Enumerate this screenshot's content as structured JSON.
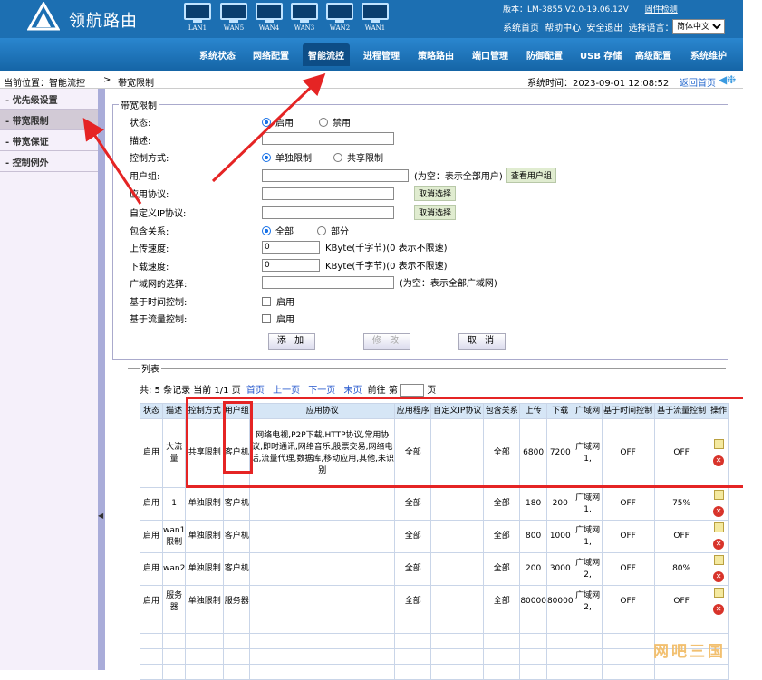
{
  "header": {
    "brand": "领航路由",
    "ports": [
      "LAN1",
      "WAN5",
      "WAN4",
      "WAN3",
      "WAN2",
      "WAN1"
    ],
    "version_label": "版本：LM-3855 V2.0-19.06.12V",
    "upgrade_link": "固件检测",
    "links": [
      "系统首页",
      "帮助中心",
      "安全退出"
    ],
    "lang_label": "选择语言：",
    "lang_value": "简体中文"
  },
  "nav": [
    "系统状态",
    "网络配置",
    "智能流控",
    "进程管理",
    "策略路由",
    "端口管理",
    "防御配置",
    "USB 存储",
    "高级配置",
    "系统维护"
  ],
  "breadcrumb": {
    "position": "当前位置：智能流控",
    "separator": ">",
    "current": "带宽限制",
    "system_time": "系统时间：2023-09-01 12:08:52",
    "home": "返回首页"
  },
  "sidebar": [
    "优先级设置",
    "带宽限制",
    "带宽保证",
    "控制例外"
  ],
  "form": {
    "legend": "带宽限制",
    "status_label": "状态:",
    "status_on": "启用",
    "status_off": "禁用",
    "desc_label": "描述:",
    "mode_label": "控制方式:",
    "mode_single": "单独限制",
    "mode_shared": "共享限制",
    "usergroup_label": "用户组:",
    "usergroup_hint": "(为空：表示全部用户)",
    "usergroup_btn": "查看用户组",
    "app_label": "应用协议:",
    "cancel_select": "取消选择",
    "custom_ip_label": "自定义IP协议:",
    "include_label": "包含关系:",
    "include_all": "全部",
    "include_part": "部分",
    "up_label": "上传速度:",
    "up_value": "0",
    "up_unit": "KByte(千字节)(0 表示不限速)",
    "down_label": "下载速度:",
    "down_value": "0",
    "down_unit": "KByte(千字节)(0 表示不限速)",
    "wan_label": "广域网的选择:",
    "wan_hint": "(为空：表示全部广域网)",
    "time_label": "基于时间控制:",
    "flow_label": "基于流量控制:",
    "enable": "启用",
    "btn_add": "添 加",
    "btn_edit": "修 改",
    "btn_cancel": "取 消"
  },
  "list": {
    "legend": "列表",
    "summary": "共: 5 条记录 当前 1/1 页",
    "first": "首页",
    "prev": "上一页",
    "next": "下一页",
    "last": "末页",
    "goto": "前往 第",
    "page_unit": "页",
    "columns": [
      "状态",
      "描述",
      "控制方式",
      "用户组",
      "应用协议",
      "应用程序",
      "自定义IP协议",
      "包含关系",
      "上传",
      "下载",
      "广域网",
      "基于时间控制",
      "基于流量控制",
      "操作"
    ],
    "rows": [
      [
        "启用",
        "大流量",
        "共享限制",
        "客户机",
        "网络电视,P2P下载,HTTP协议,常用协议,即时通讯,网络音乐,股票交易,网络电话,流量代理,数据库,移动应用,其他,未识别",
        "全部",
        "",
        "全部",
        "6800",
        "7200",
        "广域网1,",
        "OFF",
        "OFF"
      ],
      [
        "启用",
        "1",
        "单独限制",
        "客户机",
        "",
        "全部",
        "",
        "全部",
        "180",
        "200",
        "广域网1,",
        "OFF",
        "75%"
      ],
      [
        "启用",
        "wan1限制",
        "单独限制",
        "客户机",
        "",
        "全部",
        "",
        "全部",
        "800",
        "1000",
        "广域网1,",
        "OFF",
        "OFF"
      ],
      [
        "启用",
        "wan2",
        "单独限制",
        "客户机",
        "",
        "全部",
        "",
        "全部",
        "200",
        "3000",
        "广域网2,",
        "OFF",
        "80%"
      ],
      [
        "启用",
        "服务器",
        "单独限制",
        "服务器",
        "",
        "全部",
        "",
        "全部",
        "80000",
        "80000",
        "广域网2,",
        "OFF",
        "OFF"
      ]
    ],
    "empty_rows": 4
  },
  "lang_options_selected": "简体中文",
  "watermark": "网吧三国"
}
